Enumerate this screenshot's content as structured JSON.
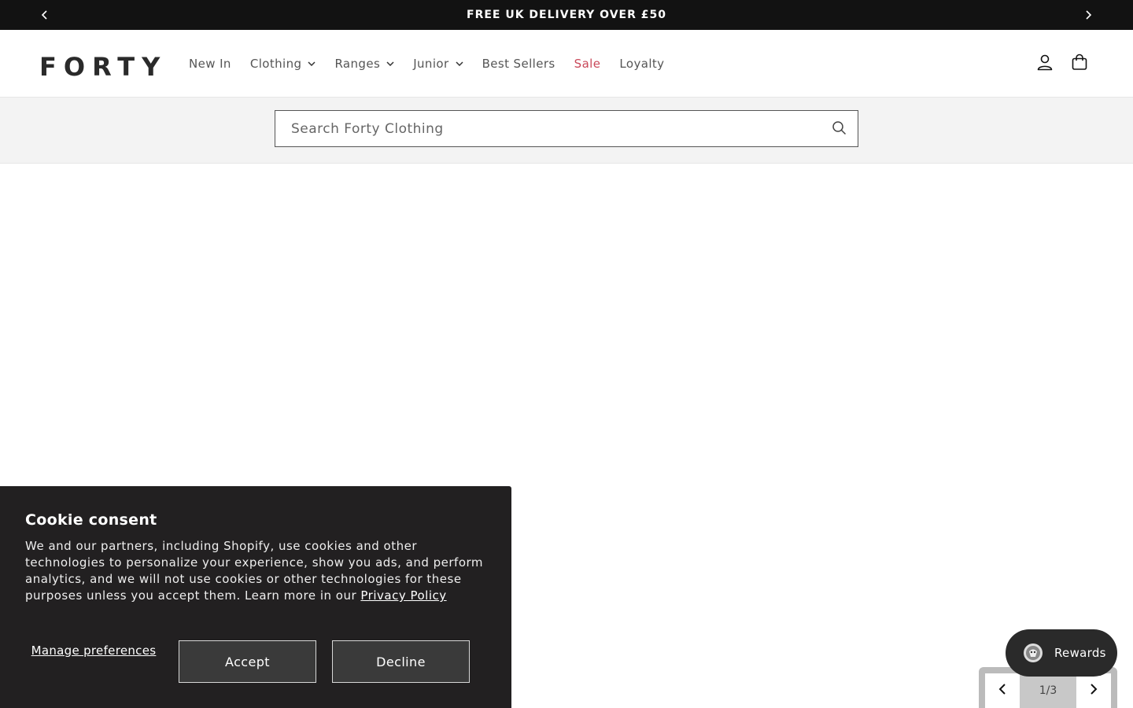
{
  "announcement": {
    "text": "FREE UK DELIVERY OVER £50",
    "prev_icon": "chevron-left-icon",
    "next_icon": "chevron-right-icon"
  },
  "header": {
    "logo": "FORTY",
    "nav": [
      {
        "label": "New In",
        "has_dropdown": false
      },
      {
        "label": "Clothing",
        "has_dropdown": true
      },
      {
        "label": "Ranges",
        "has_dropdown": true
      },
      {
        "label": "Junior",
        "has_dropdown": true
      },
      {
        "label": "Best Sellers",
        "has_dropdown": false
      },
      {
        "label": "Sale",
        "has_dropdown": false
      },
      {
        "label": "Loyalty",
        "has_dropdown": false
      }
    ],
    "sale_color": "#c94859",
    "icons": [
      "account-icon",
      "cart-icon"
    ]
  },
  "search": {
    "placeholder": "Search Forty Clothing",
    "value": "",
    "icon": "search-icon"
  },
  "cookie": {
    "title": "Cookie consent",
    "body": "We and our partners, including Shopify, use cookies and other technologies to personalize your experience, show you ads, and perform analytics, and we will not use cookies or other technologies for these purposes unless you accept them. Learn more in our ",
    "link": "Privacy Policy",
    "manage": "Manage preferences",
    "accept": "Accept",
    "decline": "Decline"
  },
  "rewards": {
    "label": "Rewards",
    "icon": "rewards-badge-icon"
  },
  "slider": {
    "counter": "1/3",
    "prev_icon": "chevron-left-icon",
    "next_icon": "chevron-right-icon"
  }
}
